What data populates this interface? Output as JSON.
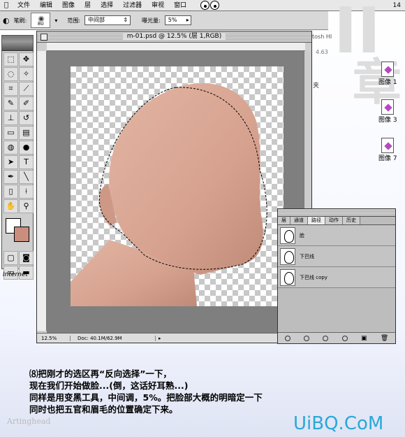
{
  "menubar": {
    "items": [
      "文件",
      "编辑",
      "图像",
      "层",
      "选择",
      "过滤器",
      "审视",
      "窗口"
    ],
    "time": "14"
  },
  "options": {
    "brush_label": "笔刷:",
    "brush_size": "80",
    "range_label": "范围:",
    "range_value": "中间部",
    "exposure_label": "曝光量:",
    "exposure_value": "5%"
  },
  "document": {
    "title": "m-01.psd @ 12.5% (层 1,RGB)",
    "zoom": "12.5%",
    "doc_size": "Doc: 40.1M/62.9M"
  },
  "paths_panel": {
    "tabs": [
      "层",
      "通道",
      "路径",
      "动作",
      "历史"
    ],
    "active_tab": "路径",
    "items": [
      "脸",
      "下巴线",
      "下巴线 copy"
    ]
  },
  "desktop": {
    "icons": [
      "图像 1",
      "图像 3",
      "图像 7"
    ],
    "fragment_1": "tosh HI",
    "fragment_2": "4.63",
    "fragment_3": "夹",
    "internet": "Internet"
  },
  "caption": {
    "line1": "⑻把刚才的选区再“反向选择”一下，",
    "line2": "现在我们开始做脸...(倒，这话好耳熟...)",
    "line3": "同样是用变黑工具，中间调，5%。把脸部大概的明暗定一下",
    "line4": "同时也把五官和眉毛的位置确定下来。"
  },
  "watermark": "Artinghead",
  "brand": "UiBQ.CoM",
  "colors": {
    "skin": "#d9a896",
    "brand": "#2aa8d8",
    "background": "#c98e7d"
  }
}
